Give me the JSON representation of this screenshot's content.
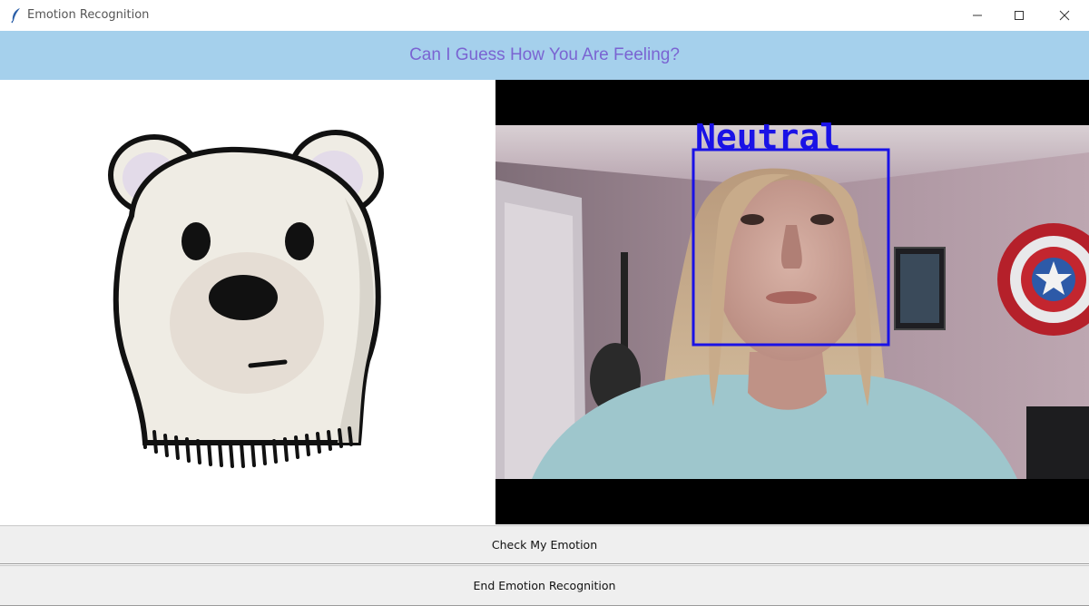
{
  "window": {
    "title": "Emotion Recognition",
    "app_icon": "feather-icon",
    "controls": [
      "minimize-icon",
      "maximize-icon",
      "close-icon"
    ]
  },
  "header": {
    "text": "Can I Guess How You Are Feeling?",
    "background": "#a5d0ec",
    "text_color": "#7a64d2"
  },
  "emoji": {
    "icon": "neutral-bear-icon"
  },
  "video": {
    "detected_emotion": "Neutral",
    "box_color": "#1a12e6"
  },
  "buttons": {
    "check_label": "Check My Emotion",
    "end_label": "End Emotion Recognition"
  }
}
